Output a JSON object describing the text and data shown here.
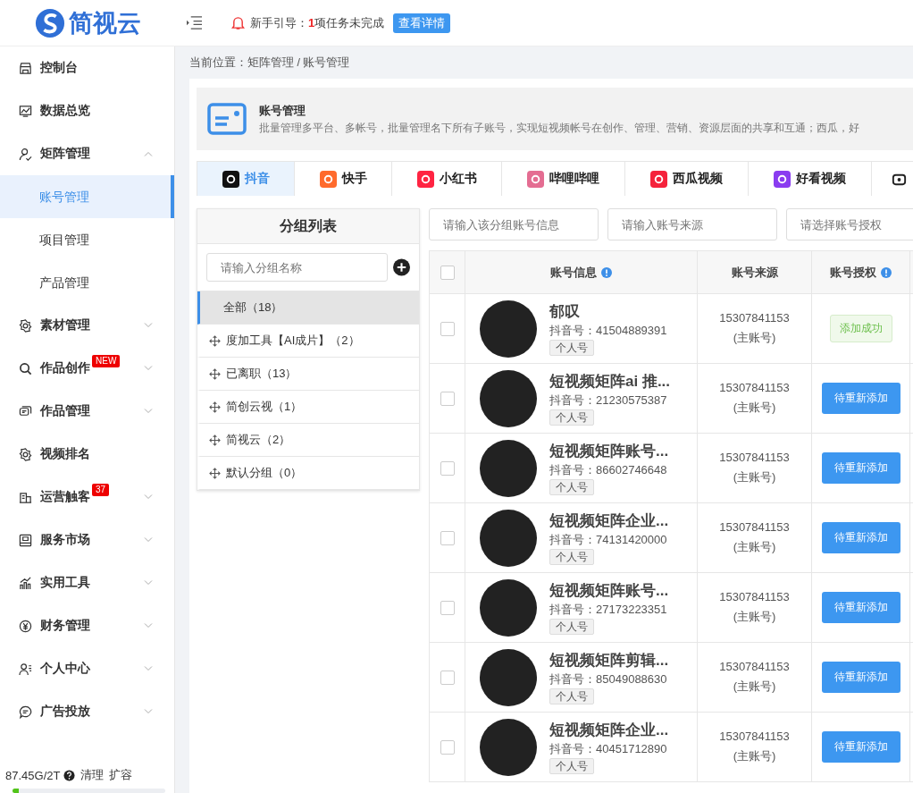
{
  "header": {
    "logo": "简视云",
    "guide_label": "新手引导：",
    "guide_count": "1",
    "guide_text": "项任务未完成",
    "guide_button": "查看详情"
  },
  "sidebar": {
    "items": [
      {
        "label": "控制台",
        "expandable": false
      },
      {
        "label": "数据总览",
        "expandable": false
      },
      {
        "label": "矩阵管理",
        "expandable": true,
        "expanded": true,
        "children": [
          {
            "label": "账号管理",
            "selected": true
          },
          {
            "label": "项目管理",
            "selected": false
          },
          {
            "label": "产品管理",
            "selected": false
          }
        ]
      },
      {
        "label": "素材管理",
        "expandable": true,
        "expanded": false
      },
      {
        "label": "作品创作",
        "expandable": true,
        "expanded": false,
        "badge": "NEW"
      },
      {
        "label": "作品管理",
        "expandable": true,
        "expanded": false
      },
      {
        "label": "视频排名",
        "expandable": false
      },
      {
        "label": "运营触客",
        "expandable": true,
        "expanded": false,
        "badge": "37"
      },
      {
        "label": "服务市场",
        "expandable": true,
        "expanded": false
      },
      {
        "label": "实用工具",
        "expandable": true,
        "expanded": false
      },
      {
        "label": "财务管理",
        "expandable": true,
        "expanded": false
      },
      {
        "label": "个人中心",
        "expandable": true,
        "expanded": false
      },
      {
        "label": "广告投放",
        "expandable": true,
        "expanded": false
      }
    ],
    "storage": {
      "usage": "87.45G/2T",
      "clean": "清理",
      "expand": "扩容",
      "level": 0.04
    }
  },
  "breadcrumb": {
    "label": "当前位置：",
    "path": "矩阵管理 / 账号管理"
  },
  "banner": {
    "title": "账号管理",
    "description": "批量管理多平台、多帐号，批量管理名下所有子账号，实现短视频帐号在创作、管理、营销、资源层面的共享和互通；西瓜，好"
  },
  "platform_tabs": [
    {
      "label": "抖音",
      "selected": true,
      "color": "#111111"
    },
    {
      "label": "快手",
      "selected": false,
      "color": "#ff6a2c"
    },
    {
      "label": "小红书",
      "selected": false,
      "color": "#ff2442"
    },
    {
      "label": "哔哩哔哩",
      "selected": false,
      "color": "#e46d92"
    },
    {
      "label": "西瓜视频",
      "selected": false,
      "color": "#f5223b"
    },
    {
      "label": "好看视频",
      "selected": false,
      "color": "#8a3cf0"
    }
  ],
  "group_panel": {
    "title": "分组列表",
    "search_placeholder": "请输入分组名称",
    "groups": [
      {
        "label": "全部（18）",
        "selected": true,
        "draggable": false
      },
      {
        "label": "度加工具【AI成片】（2）",
        "selected": false,
        "draggable": true
      },
      {
        "label": "已离职（13）",
        "selected": false,
        "draggable": true
      },
      {
        "label": "简创云视（1）",
        "selected": false,
        "draggable": true
      },
      {
        "label": "简视云（2）",
        "selected": false,
        "draggable": true
      },
      {
        "label": "默认分组（0）",
        "selected": false,
        "draggable": true
      }
    ]
  },
  "filters": [
    {
      "placeholder": "请输入该分组账号信息"
    },
    {
      "placeholder": "请输入账号来源"
    },
    {
      "placeholder": "请选择账号授权"
    }
  ],
  "table": {
    "select_all_checked": false,
    "columns": [
      {
        "label": "账号信息",
        "info": true
      },
      {
        "label": "账号来源",
        "info": false
      },
      {
        "label": "账号授权",
        "info": true
      }
    ],
    "rows": [
      {
        "checked": false,
        "name": "郁叹",
        "id_label": "抖音号：",
        "id": "41504889391",
        "tag": "个人号",
        "source": "15307841153",
        "source_note": "(主账号)",
        "auth": "添加成功",
        "kind": "success"
      },
      {
        "checked": false,
        "name": "短视频矩阵ai 推...",
        "id_label": "抖音号：",
        "id": "21230575387",
        "tag": "个人号",
        "source": "15307841153",
        "source_note": "(主账号)",
        "auth": "待重新添加",
        "kind": "retry"
      },
      {
        "checked": false,
        "name": "短视频矩阵账号...",
        "id_label": "抖音号：",
        "id": "86602746648",
        "tag": "个人号",
        "source": "15307841153",
        "source_note": "(主账号)",
        "auth": "待重新添加",
        "kind": "retry"
      },
      {
        "checked": false,
        "name": "短视频矩阵企业...",
        "id_label": "抖音号：",
        "id": "74131420000",
        "tag": "个人号",
        "source": "15307841153",
        "source_note": "(主账号)",
        "auth": "待重新添加",
        "kind": "retry"
      },
      {
        "checked": false,
        "name": "短视频矩阵账号...",
        "id_label": "抖音号：",
        "id": "27173223351",
        "tag": "个人号",
        "source": "15307841153",
        "source_note": "(主账号)",
        "auth": "待重新添加",
        "kind": "retry"
      },
      {
        "checked": false,
        "name": "短视频矩阵剪辑...",
        "id_label": "抖音号：",
        "id": "85049088630",
        "tag": "个人号",
        "source": "15307841153",
        "source_note": "(主账号)",
        "auth": "待重新添加",
        "kind": "retry"
      },
      {
        "checked": false,
        "name": "短视频矩阵企业...",
        "id_label": "抖音号：",
        "id": "40451712890",
        "tag": "个人号",
        "source": "15307841153",
        "source_note": "(主账号)",
        "auth": "待重新添加",
        "kind": "retry"
      }
    ]
  }
}
